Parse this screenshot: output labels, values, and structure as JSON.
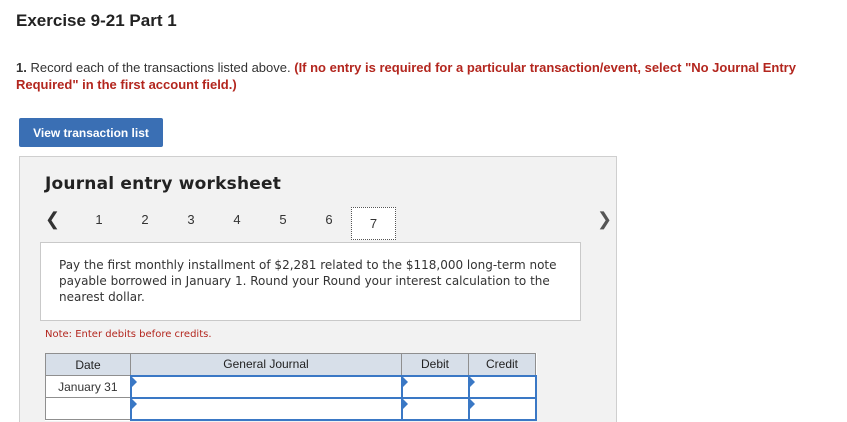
{
  "header": {
    "title": "Exercise 9-21 Part 1"
  },
  "instructions": {
    "number": "1.",
    "text": " Record each of the transactions listed above. ",
    "emphasis": "(If no entry is required for a particular transaction/event, select \"No Journal Entry Required\" in the first account field.)"
  },
  "buttons": {
    "view_transactions": "View transaction list"
  },
  "worksheet": {
    "title": "Journal entry worksheet",
    "prev_icon": "chevron-left-icon",
    "next_icon": "chevron-right-icon",
    "tabs": [
      "1",
      "2",
      "3",
      "4",
      "5",
      "6",
      "7"
    ],
    "active_tab": "7",
    "description": "Pay the first monthly installment of $2,281 related to the $118,000 long-term note payable borrowed in January 1. Round your Round your interest calculation to the nearest dollar.",
    "note": "Note: Enter debits before credits.",
    "table": {
      "headers": [
        "Date",
        "General Journal",
        "Debit",
        "Credit"
      ],
      "rows": [
        {
          "date": "January 31"
        },
        {
          "date": ""
        }
      ]
    }
  },
  "colors": {
    "accent": "#3a6fb4",
    "emphasis_red": "#b3261e",
    "header_bg": "#d7dfe9"
  }
}
